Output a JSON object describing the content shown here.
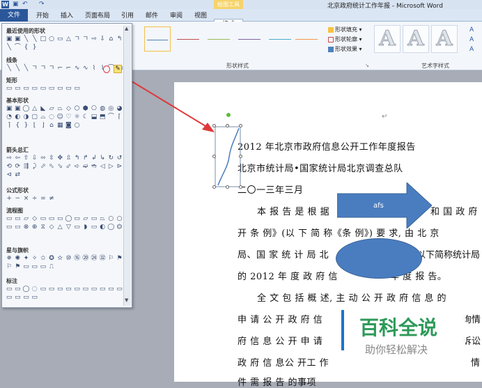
{
  "window": {
    "title": "北京政府统计工作年报 - Microsoft Word"
  },
  "tabs": {
    "file": "文件",
    "items": [
      "开始",
      "插入",
      "页面布局",
      "引用",
      "邮件",
      "审阅",
      "视图"
    ],
    "context_group": "绘图工具",
    "format": "格式"
  },
  "ribbon": {
    "group_shape_styles": "形状样式",
    "group_wordart": "艺术字样式",
    "fill": "形状填充",
    "outline": "形状轮廓",
    "effects": "形状效果",
    "wordart_letter": "A"
  },
  "panel": {
    "sections": [
      "最近使用的形状",
      "线条",
      "矩形",
      "基本形状",
      "箭头总汇",
      "公式形状",
      "流程图",
      "星与旗帜",
      "标注"
    ],
    "symbols": {
      "recent": "▣▣╲╲□○▭△ㄱㄱ⇨⇩⌂↰╲⌒{}",
      "lines": "╲╲╲ㄱㄱㄱ⌐⌐∿∿⌇⌇⌒◯",
      "rect": "▭▭▭▭▭▭▭▭▭",
      "basic": "▣▣◯△◣▱⏢◇⬡⬢⎔◍◎◕◔◐◑▢⌓◌☺♡☼☾⬓⬒⌒⌈⌉{}⌊⌋⌂▦◙○",
      "arrows": "⇨⇦⇧⇩⬄⇳✥⇫↰↱↲↳↻↺⟲⟳⇶⤸⬀⬁⬂⬃➪➫➬◁▷⊳⊲⇄",
      "equation": "+−×÷=≠",
      "flow": "▭▭▱◇▭▭▭◯▭▱▭⏢○○▭▭⊗⊕⧖◇△▽▭◗▭◐◯⏣",
      "stars": "✵✺✦✧✩✪✫⑩⑯⑳㉔㉜⚐⚑⚐⚑▭▭▭⎍",
      "callouts": "▭▭◯◌▭▭▭▭▭▭▭▭▭▭▭▭▭▭"
    }
  },
  "doc": {
    "lines": [
      "2012 年北京市政府信息公开工作年度报告",
      "北京市统计局•国家统计局北京调查总队",
      "二〇一三年三月",
      "本 报 告 是 根 据",
      "和 国 政 府",
      "开 条 例》(以 下 简 称《条 例》) 要 求, 由 北 京",
      "局、国 家 统 计 局 北",
      "以下简称统计局",
      "的 2012 年 度 政 府 信",
      "年 度 报 告。",
      "全 文 包 括 概 述, 主 动 公 开 政 府 信 息 的",
      "申 请 公 开 政 府 信",
      "询情",
      "府 信 息 公 开 申 请",
      "诉讼",
      "政 府 信 息公 开工 作",
      "情",
      "件 需 报 告 的事项"
    ],
    "arrow_label": "afs"
  },
  "watermark": {
    "big": "百科全说",
    "small": "助你轻松解决"
  },
  "colors": {
    "accent": "#2b579a",
    "shape_fill": "#4a7dc0",
    "red_arrow": "#e0383a",
    "wm_green": "#2d9a59"
  }
}
